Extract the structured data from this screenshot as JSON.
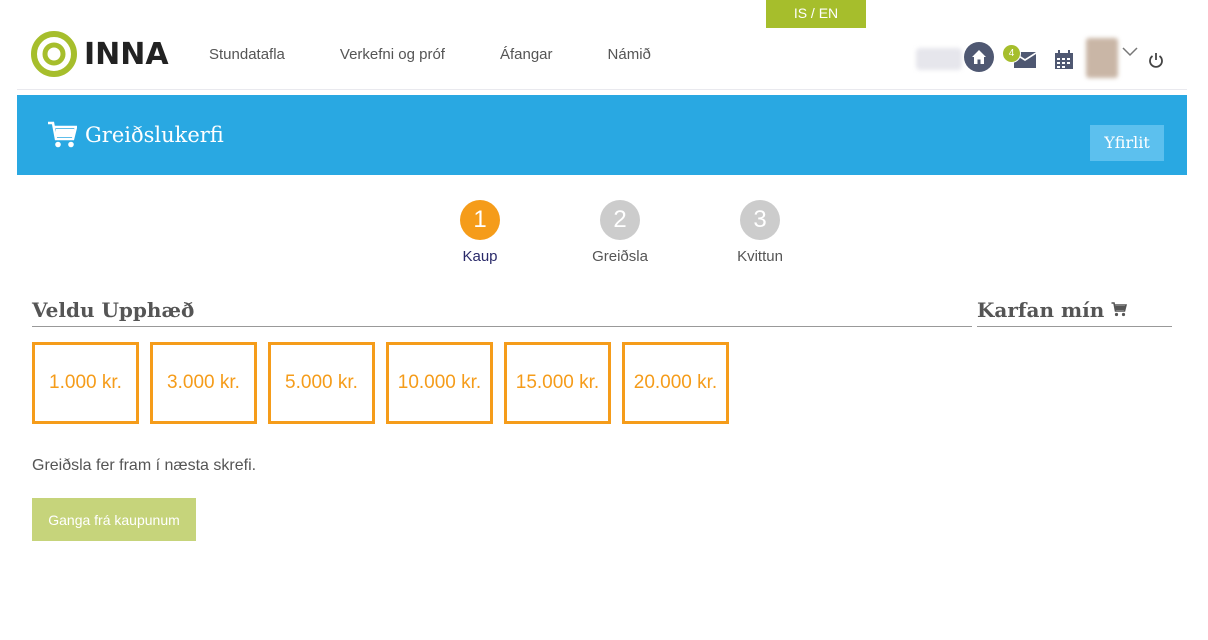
{
  "language_toggle": "IS / EN",
  "app": {
    "logo_text": "INNA",
    "brand_color": "#a6be2c"
  },
  "nav": {
    "items": [
      {
        "label": "Stundatafla"
      },
      {
        "label": "Verkefni og próf"
      },
      {
        "label": "Áfangar"
      },
      {
        "label": "Námið"
      }
    ]
  },
  "header_icons": {
    "messages_badge": "4",
    "icons": [
      "home-icon",
      "envelope-icon",
      "calendar-icon",
      "avatar",
      "chevron-down-icon",
      "power-icon"
    ]
  },
  "banner": {
    "title": "Greiðslukerfi",
    "overview_label": "Yfirlit",
    "icon": "cart-icon",
    "color": "#29a8e2"
  },
  "steps": [
    {
      "number": "1",
      "label": "Kaup",
      "active": true
    },
    {
      "number": "2",
      "label": "Greiðsla",
      "active": false
    },
    {
      "number": "3",
      "label": "Kvittun",
      "active": false
    }
  ],
  "amount_section": {
    "title": "Veldu Upphæð",
    "options": [
      "1.000 kr.",
      "3.000 kr.",
      "5.000 kr.",
      "10.000 kr.",
      "15.000 kr.",
      "20.000 kr."
    ],
    "accent_color": "#f59c1a"
  },
  "cart_section": {
    "title": "Karfan mín"
  },
  "note": "Greiðsla fer fram í næsta skrefi.",
  "checkout_label": "Ganga frá kaupunum"
}
